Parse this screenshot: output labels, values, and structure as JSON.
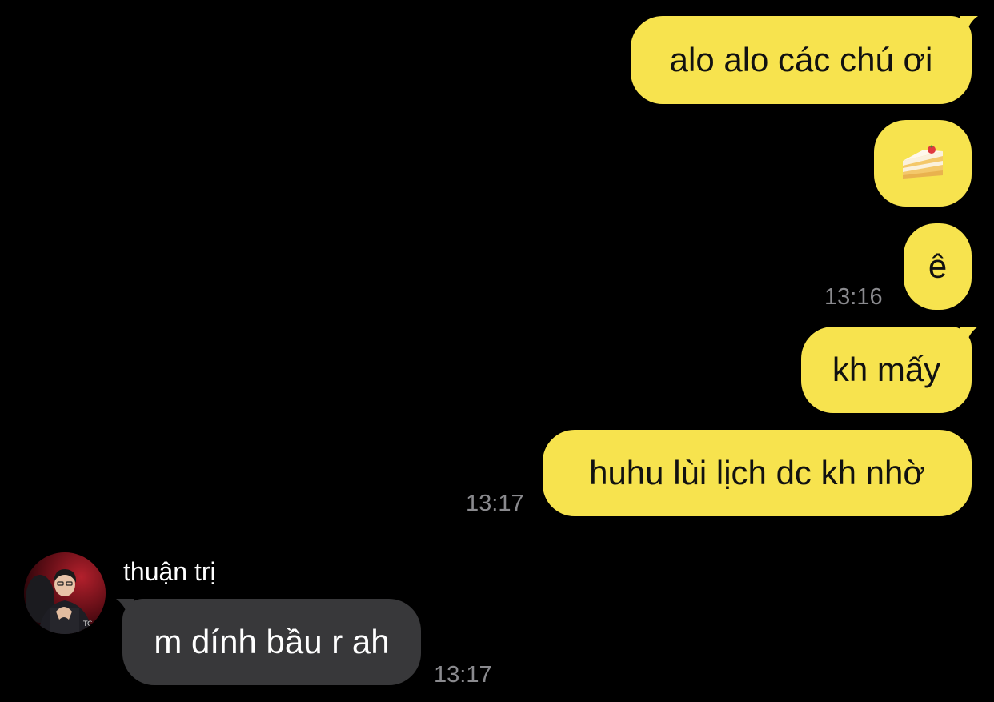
{
  "colors": {
    "background": "#000000",
    "outgoing_bubble": "#f7e34e",
    "incoming_bubble": "#38383a",
    "timestamp": "#8a8a8e"
  },
  "messages": [
    {
      "direction": "outgoing",
      "text": "alo alo các chú ơi"
    },
    {
      "direction": "outgoing",
      "emoji": "cake-emoji"
    },
    {
      "direction": "outgoing",
      "text": "ê",
      "time": "13:16"
    },
    {
      "direction": "outgoing",
      "text": "kh mấy"
    },
    {
      "direction": "outgoing",
      "text": "huhu lùi lịch dc kh nhờ",
      "time": "13:17"
    },
    {
      "direction": "incoming",
      "sender": "thuận trị",
      "text": "m dính bầu r ah",
      "time": "13:17"
    }
  ]
}
